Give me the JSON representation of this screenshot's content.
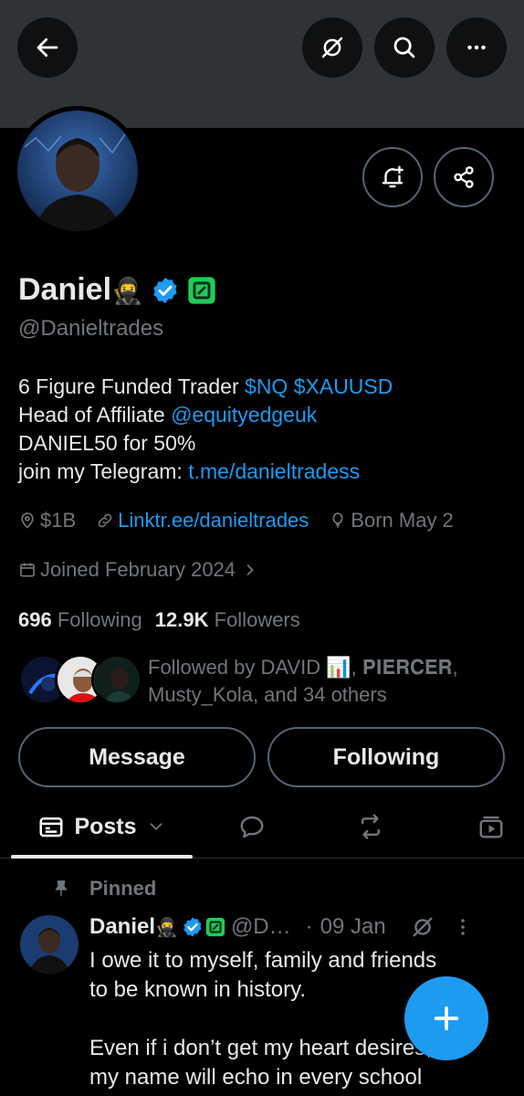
{
  "header": {
    "back_icon": "arrow-left-icon",
    "grok_icon": "grok-icon",
    "search_icon": "search-icon",
    "more_icon": "more-horizontal-icon"
  },
  "profile": {
    "display_name": "Daniel",
    "name_emoji": "🥷",
    "handle": "@Danieltrades",
    "verified_color": "#1d9bf0",
    "affiliate_badge_color": "#1fcc5a",
    "bio": {
      "line1_text": "6 Figure Funded Trader ",
      "line1_link1": "$NQ",
      "line1_link2": "$XAUUSD",
      "line2_text": "Head of Affiliate ",
      "line2_link": "@equityedgeuk",
      "line3_text": "DANIEL50 for 50%",
      "line4_text": "join my Telegram: ",
      "line4_link": "t.me/danieltradess"
    },
    "location": "$1B",
    "website": "Linktr.ee/danieltrades",
    "birthday": "Born May 2",
    "joined": "Joined February 2024",
    "following_count": "696",
    "following_label": "Following",
    "followers_count": "12.9K",
    "followers_label": "Followers",
    "followed_by_line1": "Followed by DAVID 📊, 𝐏𝐈𝐄𝐑𝐂𝐄𝐑,",
    "followed_by_line2": "Musty_Kola, and 34 others"
  },
  "actions": {
    "message_label": "Message",
    "following_label": "Following"
  },
  "tabs": {
    "posts_label": "Posts"
  },
  "pinned_post": {
    "pinned_label": "Pinned",
    "author_name": "Daniel",
    "author_emoji": "🥷",
    "author_handle": "@D…",
    "separator": "·",
    "date": "09 Jan",
    "text_line1": "I owe it to myself, family and friends",
    "text_line2": "to be known in history.",
    "text_line3": "Even if i don’t get my heart desires,",
    "text_line4": "my name will echo in every school"
  },
  "colors": {
    "accent": "#1d9bf0",
    "background": "#000000",
    "muted_text": "#71767b"
  }
}
